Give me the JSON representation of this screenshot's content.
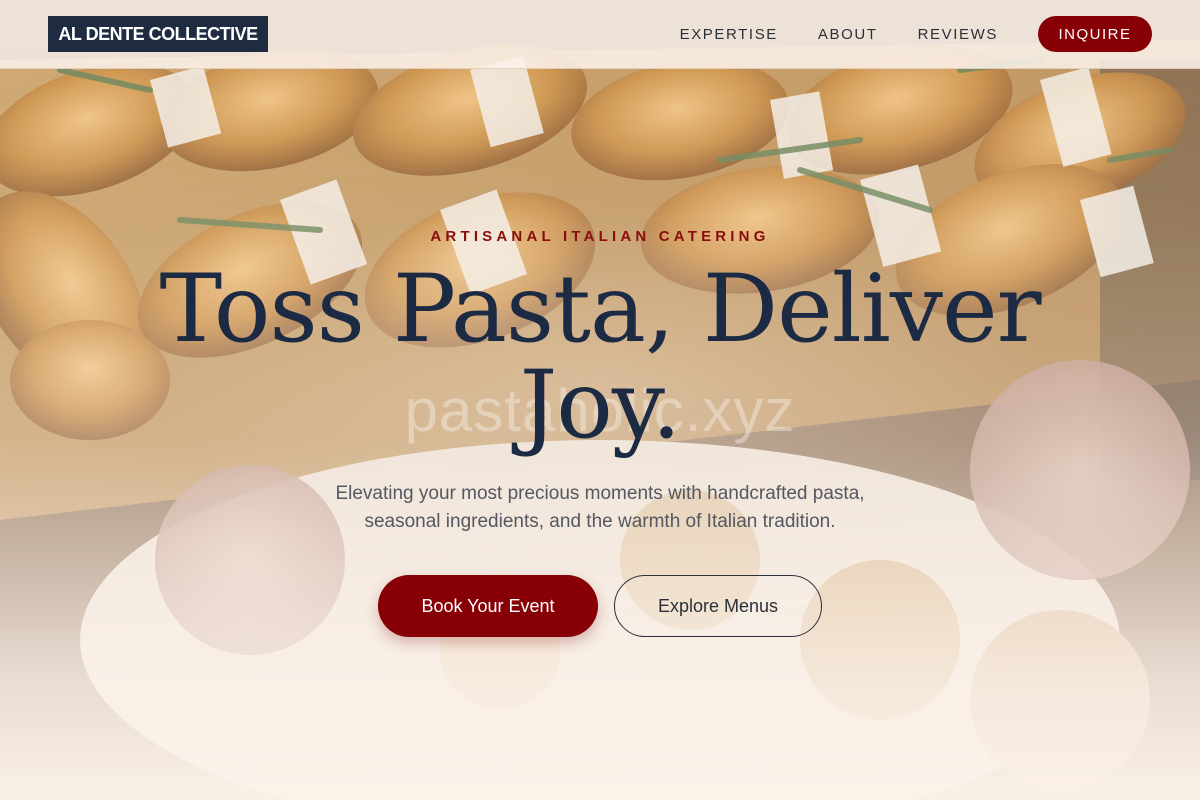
{
  "brand": {
    "logo_text": "AL DENTE COLLECTIVE"
  },
  "nav": {
    "items": [
      {
        "label": "EXPERTISE"
      },
      {
        "label": "ABOUT"
      },
      {
        "label": "REVIEWS"
      }
    ],
    "cta_label": "INQUIRE"
  },
  "hero": {
    "eyebrow": "ARTISANAL ITALIAN CATERING",
    "headline": "Toss Pasta, Deliver Joy.",
    "watermark": "pastaholic.xyz",
    "subtext": "Elevating your most precious moments with handcrafted pasta, seasonal ingredients, and the warmth of Italian tradition.",
    "primary_button": "Book Your Event",
    "secondary_button": "Explore Menus"
  },
  "colors": {
    "accent": "#870006",
    "navy": "#1c2a44",
    "background": "#fbf2ea"
  }
}
